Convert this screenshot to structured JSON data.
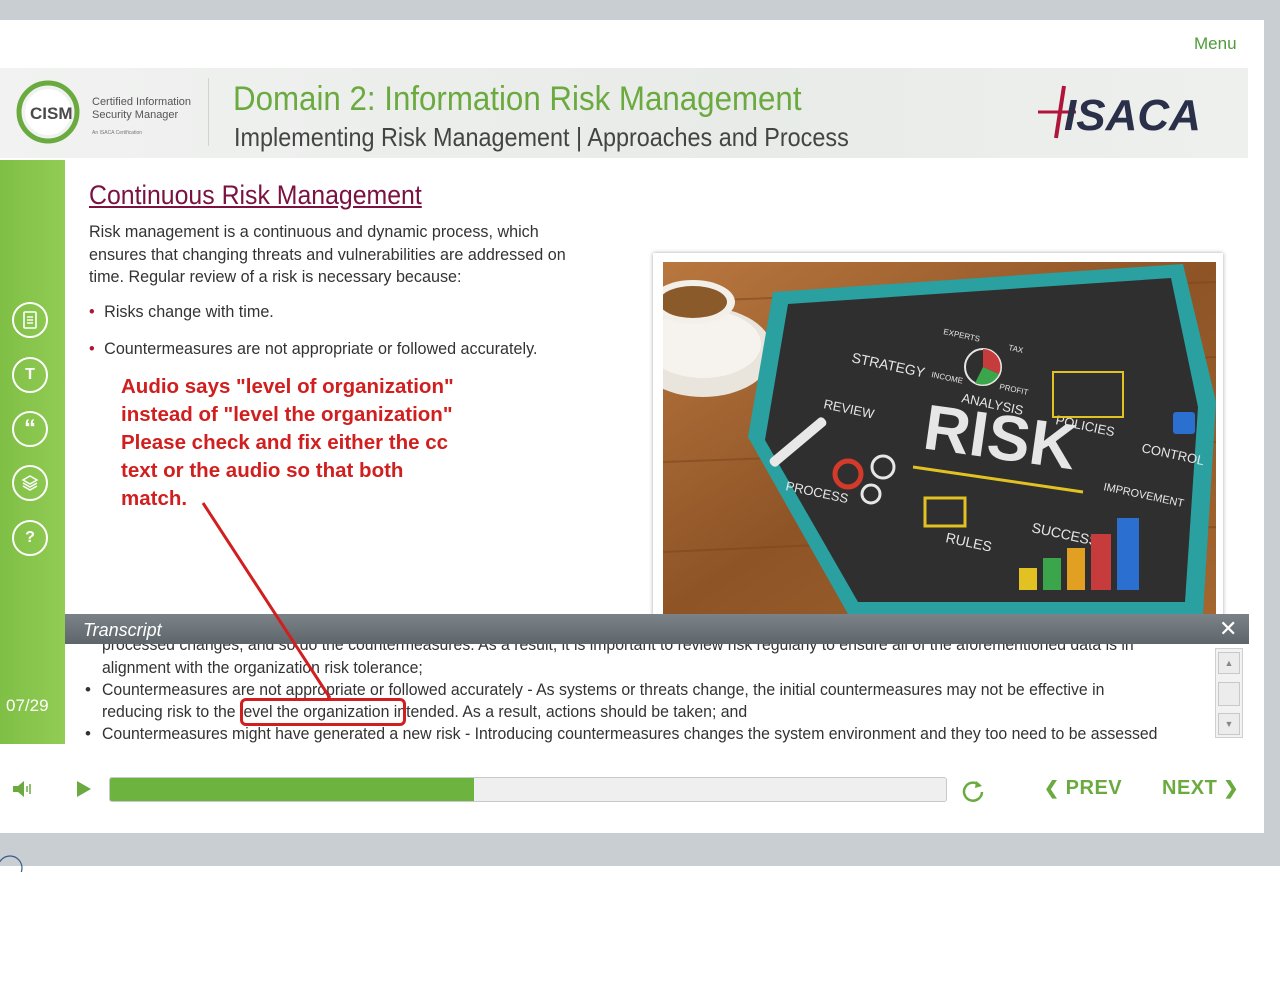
{
  "app": {
    "menu_label": "Menu",
    "cism_badge_text": "CISM",
    "cism_sub_line1": "Certified Information",
    "cism_sub_line2": "Security Manager",
    "cism_sub_tiny": "An ISACA Certification",
    "isaca_logo_text": "ISACA"
  },
  "header": {
    "title": "Domain 2: Information Risk Management",
    "subtitle": "Implementing Risk Management | Approaches and Process"
  },
  "slide": {
    "title": "Continuous Risk Management",
    "body": "Risk management is a continuous and dynamic process, which ensures that changing threats and vulnerabilities are addressed on time. Regular review of a risk is necessary because:",
    "bullets": [
      "Risks change with time.",
      "Countermeasures are not appropriate or followed accurately."
    ],
    "image_words": {
      "center": "RISK",
      "strategy": "STRATEGY",
      "analysis": "ANALYSIS",
      "policies": "POLICIES",
      "control": "CONTROL",
      "review": "REVIEW",
      "process": "PROCESS",
      "rules": "RULES",
      "success": "SUCCESS",
      "improvement": "IMPROVEMENT",
      "experts": "EXPERTS",
      "tax": "TAX",
      "income": "INCOME",
      "profit": "PROFIT"
    }
  },
  "annotation": {
    "lines": [
      "Audio says \"level of organization\"",
      "instead of \"level the organization\"",
      "Please check and fix either the cc",
      "text or the audio so that both",
      "match."
    ]
  },
  "sidebar": {
    "buttons": [
      {
        "name": "resources-button",
        "icon": "document-icon"
      },
      {
        "name": "text-button",
        "icon": "t-icon",
        "glyph": "T"
      },
      {
        "name": "glossary-button",
        "icon": "quote-icon",
        "glyph": "“"
      },
      {
        "name": "layers-button",
        "icon": "layers-icon"
      },
      {
        "name": "help-button",
        "icon": "help-icon",
        "glyph": "?"
      }
    ],
    "page_counter": "07/29"
  },
  "transcript": {
    "title": "Transcript",
    "close_glyph": "✕",
    "lines": [
      "processed changes, and so do the countermeasures. As a result, it is important to review risk regularly to ensure all of the aforementioned data is in",
      "alignment with the organization risk tolerance;",
      "Countermeasures are not appropriate or followed accurately - As systems or threats change, the initial countermeasures may not be effective in",
      "reducing risk to the level the organization intended. As a result, actions should be taken; and",
      "Countermeasures might have generated a new risk - Introducing countermeasures changes the system environment and they too need to be assessed"
    ],
    "bullet_glyph": "•"
  },
  "player": {
    "progress_percent": 43.5,
    "prev_label": "PREV",
    "next_label": "NEXT"
  },
  "colors": {
    "accent_green": "#6aaa3f",
    "title_maroon": "#7a1140",
    "annotation_red": "#d11e1e"
  }
}
